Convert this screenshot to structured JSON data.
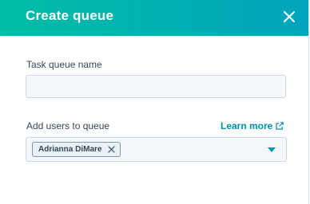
{
  "header": {
    "title": "Create queue",
    "close_icon": "close-icon"
  },
  "form": {
    "queue_name": {
      "label": "Task queue name",
      "value": "",
      "placeholder": ""
    },
    "users": {
      "label": "Add users to queue",
      "learn_more": "Learn more",
      "learn_more_icon": "external-link-icon",
      "selected": [
        {
          "name": "Adrianna DiMare"
        }
      ],
      "dropdown_icon": "caret-down-icon"
    }
  },
  "colors": {
    "header_start": "#00bda5",
    "header_end": "#00a4bd",
    "link": "#0091ae",
    "text": "#33475b",
    "input_bg": "#f5f8fa",
    "input_border": "#cbd6e2"
  }
}
